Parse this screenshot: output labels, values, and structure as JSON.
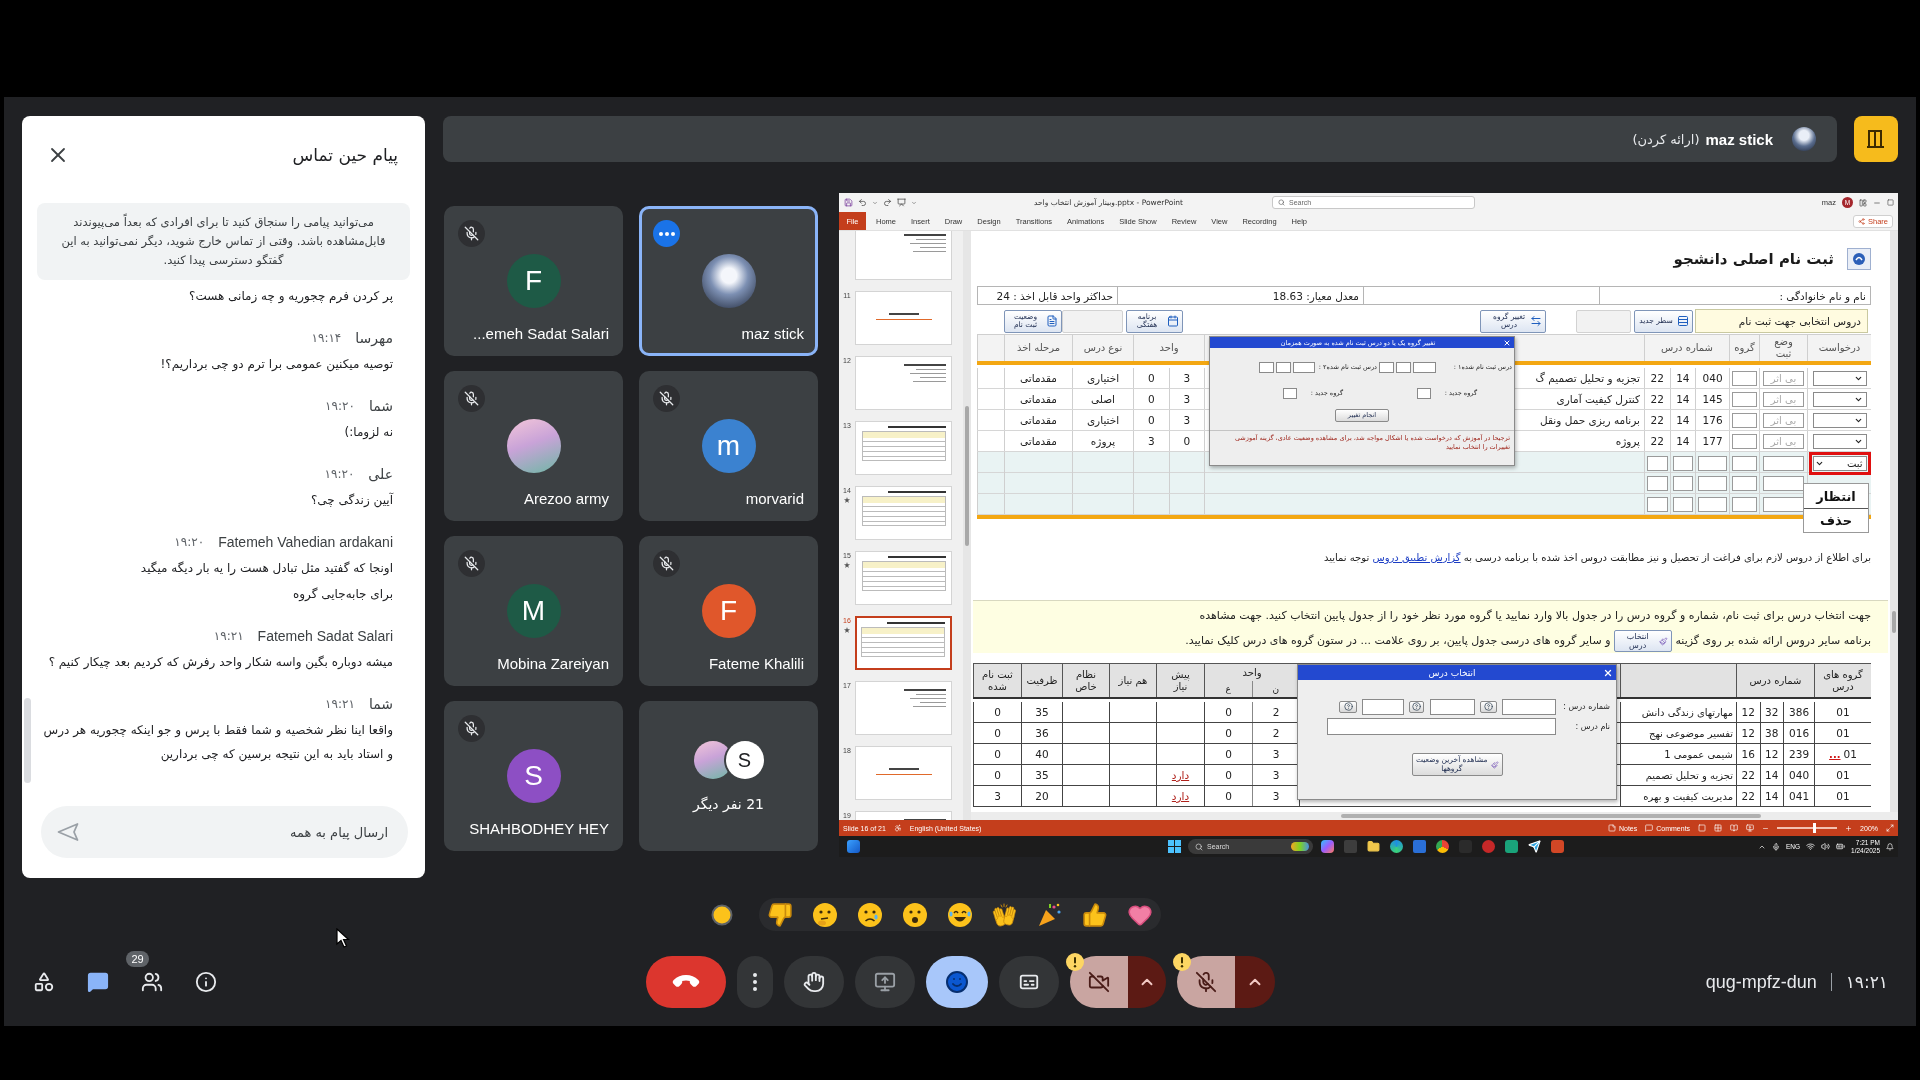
{
  "chat": {
    "title": "پیام حین تماس",
    "notice": "می‌توانید پیامی را سنجاق کنید تا برای افرادی که بعداً می‌پیوندند قابل‌مشاهده باشد. وقتی از تماس خارج شوید، دیگر نمی‌توانید به این گفتگو دسترسی پیدا کنید.",
    "messages": [
      {
        "lines": [
          "پر کردن فرم چجوریه و چه زمانی هست؟"
        ]
      },
      {
        "sender": "مهرسا",
        "time": "۱۹:۱۴",
        "lines": [
          "توصیه میکنین عمومی برا ترم دو چی برداریم؟!"
        ]
      },
      {
        "sender": "شما",
        "time": "۱۹:۲۰",
        "lines": [
          "نه لزوما:)"
        ]
      },
      {
        "sender": "علی",
        "time": "۱۹:۲۰",
        "lines": [
          "آیین زندگی چی؟"
        ]
      },
      {
        "sender": "Fatemeh Vahedian ardakani",
        "time": "۱۹:۲۰",
        "lines": [
          "اونجا که گفتید مثل تبادل هست را یه بار دیگه میگید",
          "برای جابه‌جایی گروه"
        ]
      },
      {
        "sender": "Fatemeh Sadat Salari",
        "time": "۱۹:۲۱",
        "lines": [
          "میشه دوباره بگین واسه شکار واحد رفرش که کردیم بعد چیکار کنیم ؟"
        ]
      },
      {
        "sender": "شما",
        "time": "۱۹:۲۱",
        "lines": [
          "واقعا اینا نظر شخصیه و شما فقط با پرس و جو اینکه چجوریه هر درس و استاد باید به این نتیجه برسین که چی بردارین"
        ]
      }
    ],
    "input": {
      "placeholder": "ارسال پیام به همه"
    }
  },
  "presenter": {
    "name": "maz stick",
    "status": "(ارائه کردن)"
  },
  "tiles": [
    {
      "kind": "participant",
      "name": "maz stick",
      "avatar": {
        "kind": "photo"
      },
      "muted": false,
      "speaking": true
    },
    {
      "kind": "participant",
      "name": "...emeh Sadat Salari",
      "avatar": {
        "kind": "letter",
        "letter": "F",
        "color": "#1e5a46"
      },
      "muted": true,
      "speaking": false
    },
    {
      "kind": "participant",
      "name": "morvarid",
      "avatar": {
        "kind": "letter",
        "letter": "m",
        "color": "#3b82d0"
      },
      "muted": true,
      "speaking": false
    },
    {
      "kind": "participant",
      "name": "Arezoo army",
      "avatar": {
        "kind": "photo"
      },
      "muted": true,
      "speaking": false
    },
    {
      "kind": "participant",
      "name": "Fateme Khalili",
      "avatar": {
        "kind": "letter",
        "letter": "F",
        "color": "#e0572b"
      },
      "muted": true,
      "speaking": false
    },
    {
      "kind": "participant",
      "name": "Mobina Zareiyan",
      "avatar": {
        "kind": "letter",
        "letter": "M",
        "color": "#1e5a46"
      },
      "muted": true,
      "speaking": false
    },
    {
      "kind": "others",
      "label": "21 نفر دیگر",
      "avatars": [
        {
          "kind": "letter",
          "letter": "S",
          "color": "#ffffff"
        },
        {
          "kind": "photo"
        }
      ]
    },
    {
      "kind": "participant",
      "name": "SHAHBODHEY HEY",
      "avatar": {
        "kind": "letter",
        "letter": "S",
        "color": "#8d4fc4"
      },
      "muted": true,
      "speaking": false
    }
  ],
  "presentation": {
    "window": {
      "title": "وبینار آموزش انتخاب واحد.pptx - PowerPoint",
      "search": "Search",
      "user": "maz",
      "user_initial": "M"
    },
    "ribbon": {
      "file": "File",
      "tabs": [
        "Help",
        "Recording",
        "View",
        "Review",
        "Slide Show",
        "Animations",
        "Transitions",
        "Design",
        "Draw",
        "Insert",
        "Home"
      ],
      "share": "Share"
    },
    "thumbnails": [
      {
        "kind": "text",
        "selected": false,
        "starred": false
      },
      {
        "number": "11",
        "kind": "title",
        "selected": false,
        "starred": false
      },
      {
        "number": "12",
        "kind": "text",
        "selected": false,
        "starred": false
      },
      {
        "number": "13",
        "kind": "table",
        "selected": false,
        "starred": false
      },
      {
        "number": "14",
        "kind": "table",
        "selected": false,
        "starred": true
      },
      {
        "number": "15",
        "kind": "table",
        "selected": false,
        "starred": true
      },
      {
        "number": "16",
        "kind": "table",
        "selected": true,
        "starred": true
      },
      {
        "number": "17",
        "kind": "text",
        "selected": false,
        "starred": false
      },
      {
        "number": "18",
        "kind": "title",
        "selected": false,
        "starred": false
      },
      {
        "number": "19",
        "kind": "text",
        "selected": false,
        "starred": false
      }
    ],
    "slide": {
      "title": "ثبت نام اصلی دانشجو",
      "info": {
        "name_label": "نام و نام خانوادگی :",
        "gpa": "معدل معیار: 18.63",
        "max_units": "حداکثر واحد قابل اخذ : 24"
      },
      "toolbar": {
        "label": "دروس انتخابی جهت ثبت نام",
        "right_buttons": [
          {
            "label": "سطر جدید",
            "disabled": false
          },
          {
            "disabled": true
          },
          {
            "label": "تغییر گروه درس",
            "disabled": false
          }
        ],
        "left_buttons": [
          {
            "label": "برنامه هفتگی",
            "disabled": false
          },
          {
            "disabled": true
          },
          {
            "label": "وضعیت ثبت نام",
            "disabled": false
          }
        ]
      },
      "registered": {
        "header": {
          "request": "درخواست",
          "status": "وضع ثبت",
          "group": "گروه",
          "course_number": "شماره درس",
          "units": "واحد",
          "course_type": "نوع درس",
          "stage": "مرحله اخذ"
        },
        "rows": [
          {
            "status": "بی اثر",
            "course_number": [
              "040",
              "14",
              "22"
            ],
            "course_name": "تجزیه و تحلیل تصمیم گ",
            "theory_units": "3",
            "practical_units": "0",
            "course_type": "اختیاری",
            "stage": "مقدماتی"
          },
          {
            "status": "بی اثر",
            "course_number": [
              "145",
              "14",
              "22"
            ],
            "course_name": "کنترل کیفیت آماری",
            "theory_units": "3",
            "practical_units": "0",
            "course_type": "اصلی",
            "stage": "مقدماتی"
          },
          {
            "status": "بی اثر",
            "course_number": [
              "176",
              "14",
              "22"
            ],
            "course_name": "برنامه ریزی حمل ونقل",
            "theory_units": "3",
            "practical_units": "0",
            "course_type": "اختیاری",
            "stage": "مقدماتی"
          },
          {
            "status": "بی اثر",
            "course_number": [
              "177",
              "14",
              "22"
            ],
            "course_name": "پروژه",
            "theory_units": "0",
            "practical_units": "3",
            "course_type": "پروژه",
            "stage": "مقدماتی"
          },
          {
            "request": "ثبت",
            "highlighted": true
          }
        ],
        "menu": [
          "انتظار",
          "حذف"
        ]
      },
      "group_change_dialog": {
        "title": "تغییر گروه یک یا دو درس ثبت نام شده به صورت همزمان",
        "course_fields": [
          "درس ثبت نام شده۱ :",
          "درس ثبت نام شده۲ :"
        ],
        "group_fields": [
          "گروه جدید :",
          "گروه جدید :"
        ],
        "button": "انجام تغییر",
        "note": "ترجیحا در آموزش که درخواست شده یا اشکال مواجه شد، برای مشاهده وضعیت عادی، گزینه آموزشی تغییرات را انتخاب نمایید"
      },
      "notice": {
        "before": "برای اطلاع از دروس لازم برای فراغت از تحصیل و نیز مطابقت دروس اخذ شده با برنامه درسی به",
        "link": "گزارش تطبیق دروس",
        "after": "توجه نمایید"
      },
      "instructions": {
        "line_1": "جهت انتخاب درس برای ثبت نام، شماره و گروه درس را در جدول بالا وارد نمایید یا گروه مورد نظر خود را از جدول پایین انتخاب کنید. جهت مشاهده",
        "line_2_before": "برنامه سایر دروس ارائه شده بر روی گزینه",
        "button": "انتخاب درس",
        "line_2_after": "و سایر گروه های درسی جدول پایین، بر روی علامت ... در ستون گروه های درس کلیک نمایید."
      },
      "offered": {
        "header": {
          "groups": "گروه های درس",
          "course_number": "شماره درس",
          "units": "واحد",
          "theory": "ن",
          "practical": "ع",
          "prerequisite": "پیش نیاز",
          "corequisite": "هم نیاز",
          "special": "نظام خاص",
          "capacity": "ظرفیت",
          "registered": "ثبت نام شده"
        },
        "rows": [
          {
            "group": "01",
            "course_number": [
              "386",
              "32",
              "12"
            ],
            "course_name": "مهارتهای زندگی دانش",
            "theory_units": "2",
            "practical_units": "0",
            "capacity": "35",
            "registered": "0"
          },
          {
            "group": "01",
            "course_number": [
              "016",
              "38",
              "12"
            ],
            "course_name": "تفسیر موضوعی نهج",
            "theory_units": "2",
            "practical_units": "0",
            "capacity": "36",
            "registered": "0"
          },
          {
            "group": "01",
            "mark": "...",
            "course_number": [
              "239",
              "12",
              "16"
            ],
            "course_name": "شیمی عمومی 1",
            "theory_units": "3",
            "practical_units": "0",
            "capacity": "40",
            "registered": "0"
          },
          {
            "group": "01",
            "course_number": [
              "040",
              "14",
              "22"
            ],
            "course_name": "تجزیه و تحلیل تصمیم",
            "theory_units": "3",
            "practical_units": "0",
            "prerequisite": "دارد",
            "capacity": "35",
            "registered": "0"
          },
          {
            "group": "01",
            "course_number": [
              "041",
              "14",
              "22"
            ],
            "course_name": "مدیریت کیفیت و بهره",
            "theory_units": "3",
            "practical_units": "0",
            "prerequisite": "دارد",
            "capacity": "20",
            "registered": "3"
          }
        ]
      },
      "course_dialog": {
        "title": "انتخاب درس",
        "number_label": "شماره درس :",
        "name_label": "نام درس :",
        "button": "مشاهده آخرین وضعیت گروهها"
      }
    },
    "status_bar": {
      "slide": "Slide 16 of 21",
      "language": "English (United States)",
      "notes": "Notes",
      "comments": "Comments",
      "zoom": "200%",
      "zoom_slider": {
        "level": 0.62
      }
    },
    "taskbar": {
      "search": "Search",
      "language": "ENG",
      "time": "7:21 PM",
      "date": "1/24/2025"
    }
  },
  "toolbar": {
    "left": [
      {
        "kind": "info",
        "selected": false
      },
      {
        "kind": "people",
        "selected": false,
        "badge": "29"
      },
      {
        "kind": "chat",
        "selected": true
      },
      {
        "kind": "activities",
        "selected": false
      }
    ],
    "center": [
      {
        "kind": "microphone",
        "on": false,
        "warning": true
      },
      {
        "kind": "camera",
        "on": false,
        "warning": true
      },
      {
        "kind": "captions",
        "selected": false
      },
      {
        "kind": "reactions",
        "selected": true
      },
      {
        "kind": "present",
        "selected": false
      },
      {
        "kind": "raise_hand",
        "selected": false
      },
      {
        "kind": "more"
      },
      {
        "kind": "end_call"
      }
    ],
    "meeting_code": "qug-mpfz-dun",
    "clock": "۱۹:۲۱"
  }
}
